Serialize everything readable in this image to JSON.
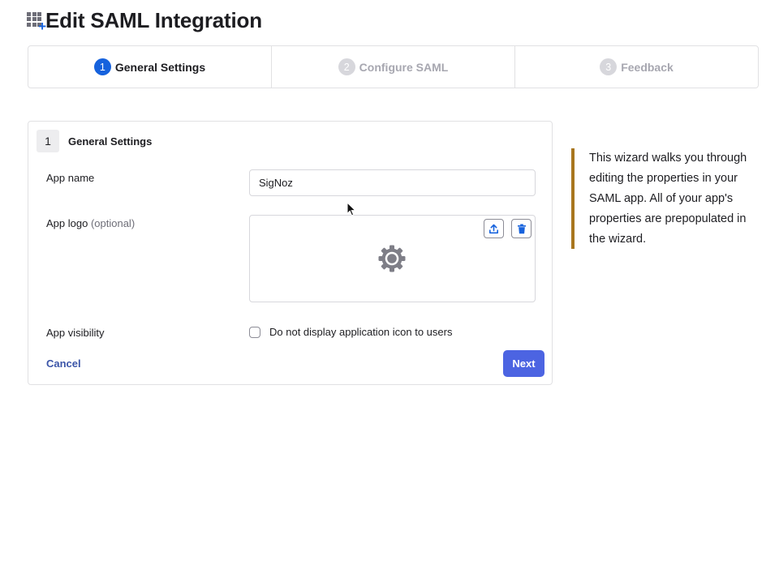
{
  "header": {
    "title": "Edit SAML Integration",
    "icon": "app-grid-plus-icon"
  },
  "stepper": {
    "steps": [
      {
        "number": "1",
        "label": "General Settings",
        "active": true
      },
      {
        "number": "2",
        "label": "Configure SAML",
        "active": false
      },
      {
        "number": "3",
        "label": "Feedback",
        "active": false
      }
    ]
  },
  "form": {
    "section_number": "1",
    "section_title": "General Settings",
    "app_name_label": "App name",
    "app_name_value": "SigNoz",
    "app_logo_label": "App logo",
    "app_logo_optional": "(optional)",
    "logo_placeholder_icon": "gear-icon",
    "upload_icon": "upload-icon",
    "delete_icon": "trash-icon",
    "visibility_label": "App visibility",
    "visibility_checkbox_label": "Do not display application icon to users",
    "visibility_checked": false,
    "cancel_label": "Cancel",
    "next_label": "Next"
  },
  "help": {
    "text": "This wizard walks you through editing the properties in your SAML app. All of your app's properties are prepopulated in the wizard."
  },
  "colors": {
    "primary": "#1662dd",
    "button": "#4c64e2",
    "link": "#3b55a8",
    "help_accent": "#a8761e"
  }
}
